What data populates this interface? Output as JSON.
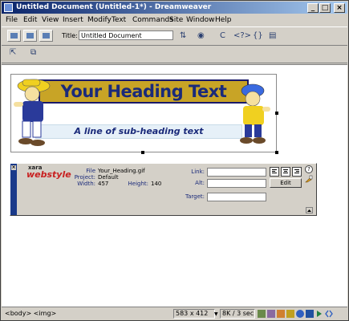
{
  "window": {
    "title": "Untitled Document (Untitled-1*) - Dreamweaver",
    "controls": {
      "minimize": "_",
      "maximize": "□",
      "close": "×"
    }
  },
  "menu": [
    "File",
    "Edit",
    "View",
    "Insert",
    "Modify",
    "Text",
    "Commands",
    "Site",
    "Window",
    "Help"
  ],
  "toolbar": {
    "title_label": "Title:",
    "title_value": "Untitled Document",
    "glyph_refresh": "C",
    "glyph_code": "<?>",
    "glyph_braces": "{}"
  },
  "document": {
    "banner": {
      "heading": "Your Heading Text",
      "subheading": "A line of sub-heading text"
    }
  },
  "properties": {
    "logo_top": "xara",
    "logo_main": "webstyle",
    "file_label": "File",
    "file_value": "Your_Heading.gif",
    "project_label": "Project:",
    "project_value": "Default",
    "width_label": "Width:",
    "width_value": "457",
    "height_label": "Height:",
    "height_value": "140",
    "link_label": "Link:",
    "alt_label": "Alt:",
    "target_label": "Target:",
    "edit_label": "Edit",
    "help_glyph": "?"
  },
  "status": {
    "tags": "<body> <img>",
    "size": "583 x 412",
    "download": "8K / 3 sec"
  },
  "colors": {
    "title_start": "#0a246a",
    "title_end": "#a6caf0",
    "banner_gold": "#c8a426",
    "banner_text": "#1a2a7a"
  }
}
